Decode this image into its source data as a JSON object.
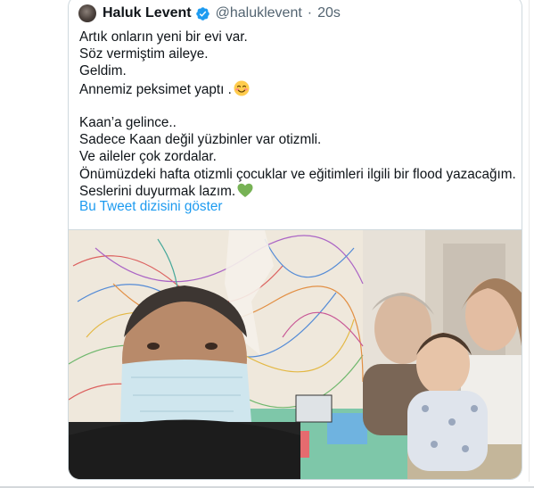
{
  "tweet": {
    "author_name": "Haluk Levent",
    "author_handle": "@haluklevent",
    "time_sep": "·",
    "time": "20s",
    "lines": [
      "Artık onların yeni bir evi var.",
      "Söz vermiştim aileye.",
      "Geldim.",
      "Annemiz peksimet yaptı ."
    ],
    "lines2": [
      "Kaan’a gelince..",
      "Sadece Kaan değil yüzbinler var otizmli.",
      "Ve aileler çok zordalar.",
      "Önümüzdeki hafta otizmli çocuklar ve eğitimleri ilgili bir flood yazacağım.",
      "Seslerini duyurmak lazım."
    ],
    "thread_link": "Bu Tweet dizisini göster"
  },
  "icons": {
    "verified": "verified-badge-icon",
    "emoji_smile": "smiling-face-icon",
    "emoji_heart": "green-heart-icon"
  },
  "colors": {
    "link": "#1d9bf0",
    "verified": "#1d9bf0",
    "muted": "#536471"
  }
}
